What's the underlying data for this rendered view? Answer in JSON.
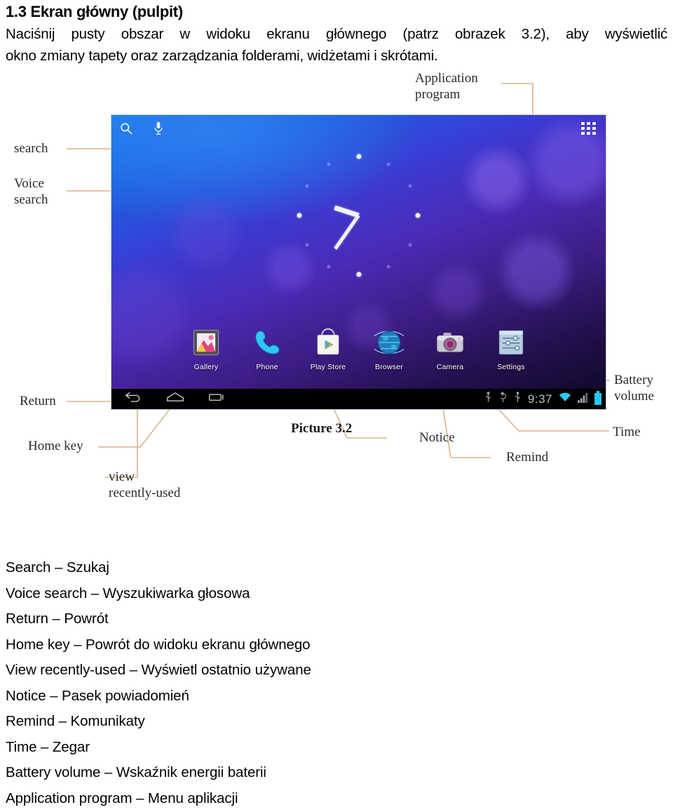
{
  "document": {
    "heading": "1.3 Ekran główny (pulpit)",
    "paragraph_line_1": "Naciśnij pusty obszar w widoku ekranu głównego (patrz obrazek 3.2), aby wyświetlić",
    "paragraph_line_2": "okno zmiany tapety oraz zarządzania folderami, widżetami i skrótami.",
    "figure_caption": "Picture 3.2"
  },
  "annotations": [
    {
      "id": "search",
      "label": "search"
    },
    {
      "id": "voice-search",
      "label": "Voice\nsearch"
    },
    {
      "id": "return",
      "label": "Return"
    },
    {
      "id": "home-key",
      "label": "Home key"
    },
    {
      "id": "view-recent",
      "label": "view\nrecently-used"
    },
    {
      "id": "application",
      "label": "Application\nprogram"
    },
    {
      "id": "battery",
      "label": "Battery\nvolume"
    },
    {
      "id": "time",
      "label": "Time"
    },
    {
      "id": "notice",
      "label": "Notice"
    },
    {
      "id": "remind",
      "label": "Remind"
    }
  ],
  "annotation_labels": {
    "search": "search",
    "voice_search": "Voice\nsearch",
    "return": "Return",
    "home_key": "Home key",
    "view_recently_used": "view\nrecently-used",
    "application_program": "Application\nprogram",
    "battery_volume": "Battery\nvolume",
    "time": "Time",
    "notice": "Notice",
    "remind": "Remind"
  },
  "device_screen": {
    "search_icon": "magnifier-icon",
    "voice_icon": "microphone-icon",
    "app_drawer_icon": "app-grid-icon",
    "clock_widget": {
      "type": "analog-clock",
      "hour_hand_degrees": 288,
      "minute_hand_degrees": 215
    },
    "apps": [
      {
        "name": "Gallery",
        "icon": "gallery-icon"
      },
      {
        "name": "Phone",
        "icon": "phone-icon"
      },
      {
        "name": "Play Store",
        "icon": "play-store-icon"
      },
      {
        "name": "Browser",
        "icon": "browser-globe-icon"
      },
      {
        "name": "Camera",
        "icon": "camera-icon"
      },
      {
        "name": "Settings",
        "icon": "settings-sliders-icon"
      }
    ],
    "nav_keys": [
      {
        "name": "Return",
        "icon": "back-arrow-icon"
      },
      {
        "name": "Home key",
        "icon": "home-icon"
      },
      {
        "name": "view recently-used",
        "icon": "recent-apps-icon"
      }
    ],
    "status_bar": {
      "time": "9:37",
      "icons": [
        "usb-icon",
        "usb-debug-icon",
        "usb-icon",
        "wifi-icon",
        "signal-bars-icon",
        "battery-icon"
      ],
      "battery_color": "#24c8f0"
    }
  },
  "glossary": [
    "Search – Szukaj",
    "Voice search – Wyszukiwarka głosowa",
    "Return – Powrót",
    "Home key – Powrót do widoku ekranu głównego",
    "View recently-used – Wyświetl ostatnio używane",
    "Notice – Pasek powiadomień",
    "Remind – Komunikaty",
    "Time – Zegar",
    "Battery volume – Wskaźnik energii baterii",
    "Application program – Menu aplikacji"
  ],
  "colors": {
    "leader_line": "#d9b48a",
    "navbar_background": "#000000",
    "battery_accent": "#24c8f0",
    "page_background": "#ffffff"
  }
}
